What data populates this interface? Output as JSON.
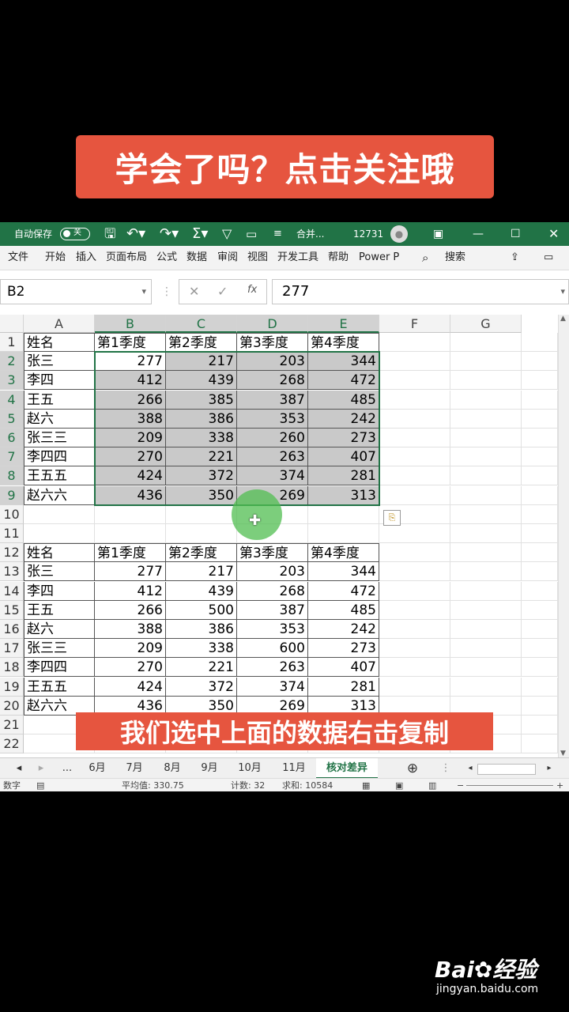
{
  "top_banner": "学会了吗？点击关注哦",
  "bottom_caption": "我们选中上面的数据右击复制",
  "watermark": {
    "logo": "Bai✿经验",
    "url": "jingyan.baidu.com"
  },
  "titlebar": {
    "autosave": "自动保存",
    "autosave_state": "关",
    "doc_name": "合并...",
    "user": "12731",
    "bg_color": "#217346"
  },
  "menu": [
    "文件",
    "开始",
    "插入",
    "页面布局",
    "公式",
    "数据",
    "审阅",
    "视图",
    "开发工具",
    "帮助",
    "Power P"
  ],
  "search_label": "搜索",
  "formula_bar": {
    "name_box": "B2",
    "value": "277",
    "fx": "fx"
  },
  "columns": [
    "A",
    "B",
    "C",
    "D",
    "E",
    "F",
    "G"
  ],
  "rows": [
    "1",
    "2",
    "3",
    "4",
    "5",
    "6",
    "7",
    "8",
    "9",
    "10",
    "11",
    "12",
    "13",
    "14",
    "15",
    "16",
    "17",
    "18",
    "19",
    "20",
    "21",
    "22"
  ],
  "table1": {
    "headers": [
      "姓名",
      "第1季度",
      "第2季度",
      "第3季度",
      "第4季度"
    ],
    "data": [
      [
        "张三",
        "277",
        "217",
        "203",
        "344"
      ],
      [
        "李四",
        "412",
        "439",
        "268",
        "472"
      ],
      [
        "王五",
        "266",
        "385",
        "387",
        "485"
      ],
      [
        "赵六",
        "388",
        "386",
        "353",
        "242"
      ],
      [
        "张三三",
        "209",
        "338",
        "260",
        "273"
      ],
      [
        "李四四",
        "270",
        "221",
        "263",
        "407"
      ],
      [
        "王五五",
        "424",
        "372",
        "374",
        "281"
      ],
      [
        "赵六六",
        "436",
        "350",
        "269",
        "313"
      ]
    ]
  },
  "table2": {
    "headers": [
      "姓名",
      "第1季度",
      "第2季度",
      "第3季度",
      "第4季度"
    ],
    "data": [
      [
        "张三",
        "277",
        "217",
        "203",
        "344"
      ],
      [
        "李四",
        "412",
        "439",
        "268",
        "472"
      ],
      [
        "王五",
        "266",
        "500",
        "387",
        "485"
      ],
      [
        "赵六",
        "388",
        "386",
        "353",
        "242"
      ],
      [
        "张三三",
        "209",
        "338",
        "600",
        "273"
      ],
      [
        "李四四",
        "270",
        "221",
        "263",
        "407"
      ],
      [
        "王五五",
        "424",
        "372",
        "374",
        "281"
      ],
      [
        "赵六六",
        "436",
        "350",
        "269",
        "313"
      ]
    ]
  },
  "sheet_tabs": [
    "...",
    "6月",
    "7月",
    "8月",
    "9月",
    "10月",
    "11月",
    "核对差异"
  ],
  "active_tab": "核对差异",
  "status": {
    "mode": "数字",
    "average": "平均值: 330.75",
    "count": "计数: 32",
    "sum": "求和: 10584"
  }
}
